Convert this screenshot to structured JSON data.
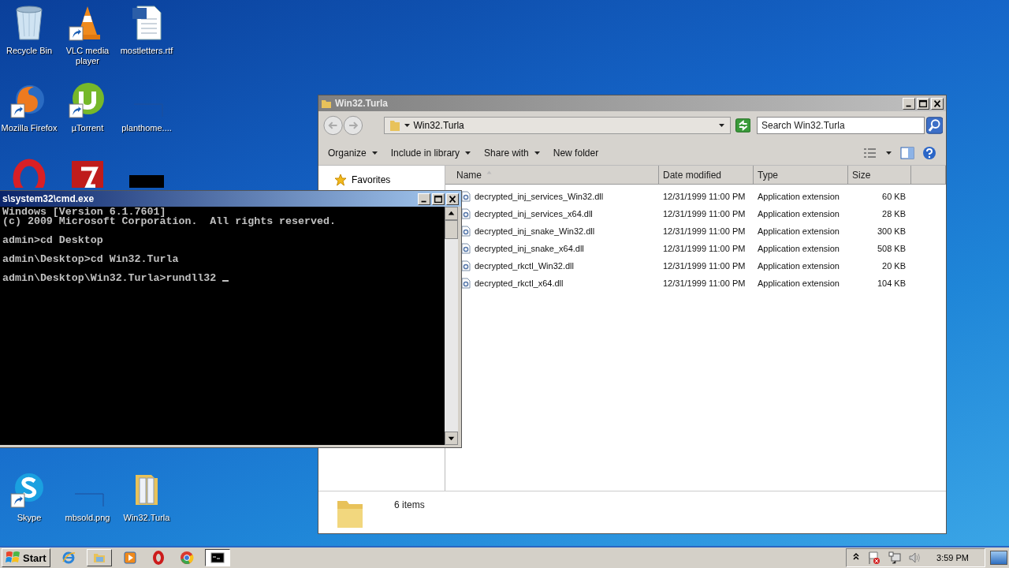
{
  "desktop": {
    "top_icons": [
      {
        "kind": "recycle",
        "label": "Recycle Bin"
      },
      {
        "kind": "vlc",
        "label": "VLC media player",
        "shortcut": true
      },
      {
        "kind": "word",
        "label": "mostletters.rtf"
      },
      {
        "kind": "firefox",
        "label": "Mozilla Firefox",
        "shortcut": true
      },
      {
        "kind": "utorrent",
        "label": "µTorrent",
        "shortcut": true
      },
      {
        "kind": "blank",
        "label": "planthome...."
      },
      {
        "kind": "opera"
      },
      {
        "kind": "filezilla"
      },
      {
        "kind": "console"
      }
    ],
    "bottom_icons": [
      {
        "kind": "skype",
        "label": "Skype",
        "shortcut": true
      },
      {
        "kind": "blank",
        "label": "mbsold.png"
      },
      {
        "kind": "folder",
        "label": "Win32.Turla"
      }
    ]
  },
  "explorer": {
    "title": "Win32.Turla",
    "active": false,
    "address": "Win32.Turla",
    "search": {
      "placeholder": "Search Win32.Turla"
    },
    "toolbar": [
      {
        "label": "Organize",
        "dropdown": true
      },
      {
        "label": "Include in library",
        "dropdown": true
      },
      {
        "label": "Share with",
        "dropdown": true
      },
      {
        "label": "New folder",
        "dropdown": false
      }
    ],
    "nav": [
      {
        "label": "Favorites"
      }
    ],
    "columns": [
      "Name",
      "Date modified",
      "Type",
      "Size"
    ],
    "rows": [
      {
        "name": "decrypted_inj_services_Win32.dll",
        "date": "12/31/1999 11:00 PM",
        "type": "Application extension",
        "size": "60 KB"
      },
      {
        "name": "decrypted_inj_services_x64.dll",
        "date": "12/31/1999 11:00 PM",
        "type": "Application extension",
        "size": "28 KB"
      },
      {
        "name": "decrypted_inj_snake_Win32.dll",
        "date": "12/31/1999 11:00 PM",
        "type": "Application extension",
        "size": "300 KB"
      },
      {
        "name": "decrypted_inj_snake_x64.dll",
        "date": "12/31/1999 11:00 PM",
        "type": "Application extension",
        "size": "508 KB"
      },
      {
        "name": "decrypted_rkctl_Win32.dll",
        "date": "12/31/1999 11:00 PM",
        "type": "Application extension",
        "size": "20 KB"
      },
      {
        "name": "decrypted_rkctl_x64.dll",
        "date": "12/31/1999 11:00 PM",
        "type": "Application extension",
        "size": "104 KB"
      }
    ],
    "status": "6 items"
  },
  "console": {
    "title": "s\\system32\\cmd.exe",
    "active": true,
    "header": [
      "Windows [Version 6.1.7601]",
      "(c) 2009 Microsoft Corporation.  All rights reserved."
    ],
    "commands": [
      "admin>cd Desktop",
      "admin\\Desktop>cd Win32.Turla",
      "admin\\Desktop\\Win32.Turla>rundll32 "
    ]
  },
  "taskbar": {
    "start": "Start",
    "items": [
      {
        "kind": "ie",
        "open": false,
        "selected": false
      },
      {
        "kind": "explorer",
        "open": true,
        "selected": false
      },
      {
        "kind": "wmp",
        "open": false,
        "selected": false
      },
      {
        "kind": "opera",
        "open": false,
        "selected": false
      },
      {
        "kind": "chrome",
        "open": false,
        "selected": false
      },
      {
        "kind": "console",
        "open": true,
        "selected": true
      }
    ],
    "tray": [
      {
        "kind": "chevron"
      },
      {
        "kind": "flag"
      },
      {
        "kind": "network"
      },
      {
        "kind": "speaker"
      }
    ],
    "clock": "3:59 PM"
  }
}
